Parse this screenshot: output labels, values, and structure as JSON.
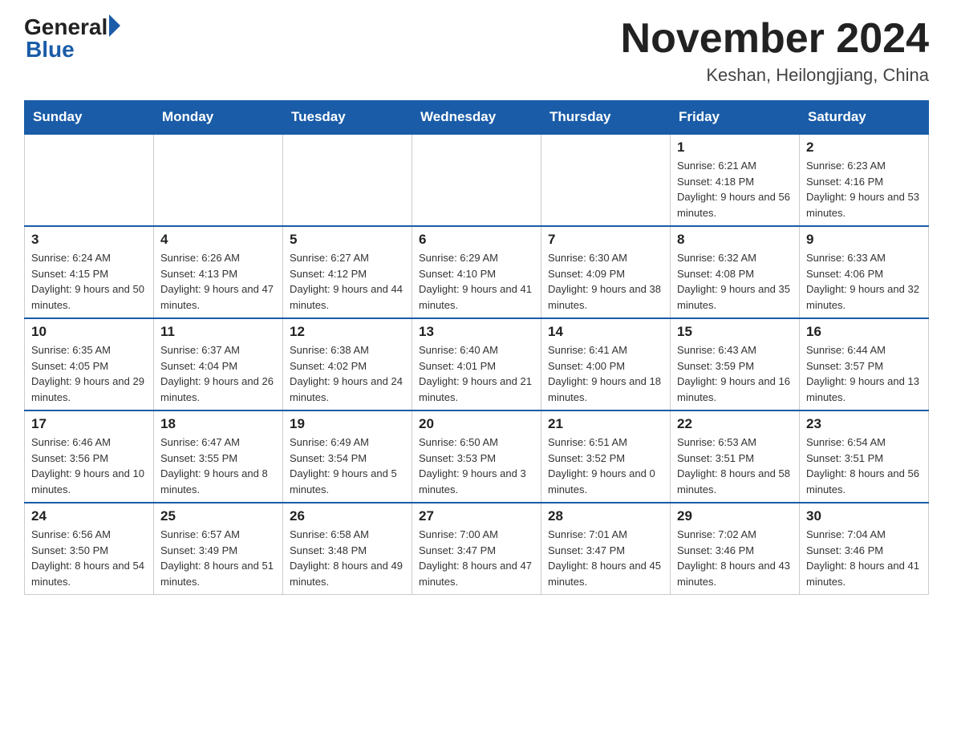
{
  "header": {
    "logo_general": "General",
    "logo_blue": "Blue",
    "month_title": "November 2024",
    "location": "Keshan, Heilongjiang, China"
  },
  "days_of_week": [
    "Sunday",
    "Monday",
    "Tuesday",
    "Wednesday",
    "Thursday",
    "Friday",
    "Saturday"
  ],
  "weeks": [
    [
      {
        "day": "",
        "info": "",
        "empty": true
      },
      {
        "day": "",
        "info": "",
        "empty": true
      },
      {
        "day": "",
        "info": "",
        "empty": true
      },
      {
        "day": "",
        "info": "",
        "empty": true
      },
      {
        "day": "",
        "info": "",
        "empty": true
      },
      {
        "day": "1",
        "info": "Sunrise: 6:21 AM\nSunset: 4:18 PM\nDaylight: 9 hours and 56 minutes.",
        "empty": false
      },
      {
        "day": "2",
        "info": "Sunrise: 6:23 AM\nSunset: 4:16 PM\nDaylight: 9 hours and 53 minutes.",
        "empty": false
      }
    ],
    [
      {
        "day": "3",
        "info": "Sunrise: 6:24 AM\nSunset: 4:15 PM\nDaylight: 9 hours and 50 minutes.",
        "empty": false
      },
      {
        "day": "4",
        "info": "Sunrise: 6:26 AM\nSunset: 4:13 PM\nDaylight: 9 hours and 47 minutes.",
        "empty": false
      },
      {
        "day": "5",
        "info": "Sunrise: 6:27 AM\nSunset: 4:12 PM\nDaylight: 9 hours and 44 minutes.",
        "empty": false
      },
      {
        "day": "6",
        "info": "Sunrise: 6:29 AM\nSunset: 4:10 PM\nDaylight: 9 hours and 41 minutes.",
        "empty": false
      },
      {
        "day": "7",
        "info": "Sunrise: 6:30 AM\nSunset: 4:09 PM\nDaylight: 9 hours and 38 minutes.",
        "empty": false
      },
      {
        "day": "8",
        "info": "Sunrise: 6:32 AM\nSunset: 4:08 PM\nDaylight: 9 hours and 35 minutes.",
        "empty": false
      },
      {
        "day": "9",
        "info": "Sunrise: 6:33 AM\nSunset: 4:06 PM\nDaylight: 9 hours and 32 minutes.",
        "empty": false
      }
    ],
    [
      {
        "day": "10",
        "info": "Sunrise: 6:35 AM\nSunset: 4:05 PM\nDaylight: 9 hours and 29 minutes.",
        "empty": false
      },
      {
        "day": "11",
        "info": "Sunrise: 6:37 AM\nSunset: 4:04 PM\nDaylight: 9 hours and 26 minutes.",
        "empty": false
      },
      {
        "day": "12",
        "info": "Sunrise: 6:38 AM\nSunset: 4:02 PM\nDaylight: 9 hours and 24 minutes.",
        "empty": false
      },
      {
        "day": "13",
        "info": "Sunrise: 6:40 AM\nSunset: 4:01 PM\nDaylight: 9 hours and 21 minutes.",
        "empty": false
      },
      {
        "day": "14",
        "info": "Sunrise: 6:41 AM\nSunset: 4:00 PM\nDaylight: 9 hours and 18 minutes.",
        "empty": false
      },
      {
        "day": "15",
        "info": "Sunrise: 6:43 AM\nSunset: 3:59 PM\nDaylight: 9 hours and 16 minutes.",
        "empty": false
      },
      {
        "day": "16",
        "info": "Sunrise: 6:44 AM\nSunset: 3:57 PM\nDaylight: 9 hours and 13 minutes.",
        "empty": false
      }
    ],
    [
      {
        "day": "17",
        "info": "Sunrise: 6:46 AM\nSunset: 3:56 PM\nDaylight: 9 hours and 10 minutes.",
        "empty": false
      },
      {
        "day": "18",
        "info": "Sunrise: 6:47 AM\nSunset: 3:55 PM\nDaylight: 9 hours and 8 minutes.",
        "empty": false
      },
      {
        "day": "19",
        "info": "Sunrise: 6:49 AM\nSunset: 3:54 PM\nDaylight: 9 hours and 5 minutes.",
        "empty": false
      },
      {
        "day": "20",
        "info": "Sunrise: 6:50 AM\nSunset: 3:53 PM\nDaylight: 9 hours and 3 minutes.",
        "empty": false
      },
      {
        "day": "21",
        "info": "Sunrise: 6:51 AM\nSunset: 3:52 PM\nDaylight: 9 hours and 0 minutes.",
        "empty": false
      },
      {
        "day": "22",
        "info": "Sunrise: 6:53 AM\nSunset: 3:51 PM\nDaylight: 8 hours and 58 minutes.",
        "empty": false
      },
      {
        "day": "23",
        "info": "Sunrise: 6:54 AM\nSunset: 3:51 PM\nDaylight: 8 hours and 56 minutes.",
        "empty": false
      }
    ],
    [
      {
        "day": "24",
        "info": "Sunrise: 6:56 AM\nSunset: 3:50 PM\nDaylight: 8 hours and 54 minutes.",
        "empty": false
      },
      {
        "day": "25",
        "info": "Sunrise: 6:57 AM\nSunset: 3:49 PM\nDaylight: 8 hours and 51 minutes.",
        "empty": false
      },
      {
        "day": "26",
        "info": "Sunrise: 6:58 AM\nSunset: 3:48 PM\nDaylight: 8 hours and 49 minutes.",
        "empty": false
      },
      {
        "day": "27",
        "info": "Sunrise: 7:00 AM\nSunset: 3:47 PM\nDaylight: 8 hours and 47 minutes.",
        "empty": false
      },
      {
        "day": "28",
        "info": "Sunrise: 7:01 AM\nSunset: 3:47 PM\nDaylight: 8 hours and 45 minutes.",
        "empty": false
      },
      {
        "day": "29",
        "info": "Sunrise: 7:02 AM\nSunset: 3:46 PM\nDaylight: 8 hours and 43 minutes.",
        "empty": false
      },
      {
        "day": "30",
        "info": "Sunrise: 7:04 AM\nSunset: 3:46 PM\nDaylight: 8 hours and 41 minutes.",
        "empty": false
      }
    ]
  ]
}
